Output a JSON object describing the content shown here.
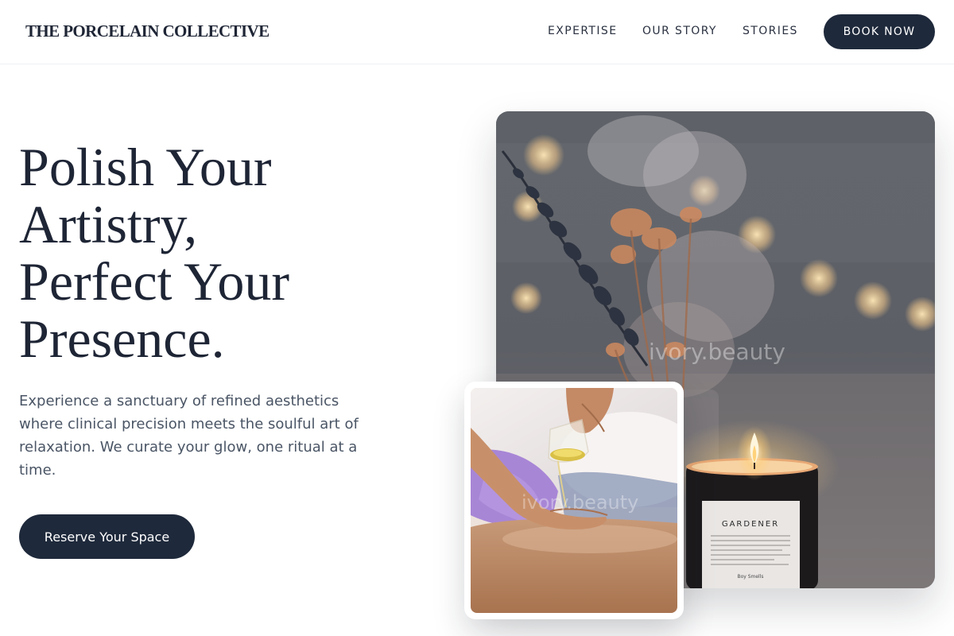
{
  "brand": {
    "name": "THE PORCELAIN COLLECTIVE"
  },
  "nav": {
    "items": [
      {
        "label": "EXPERTISE"
      },
      {
        "label": "OUR STORY"
      },
      {
        "label": "STORIES"
      }
    ],
    "cta_label": "BOOK NOW"
  },
  "hero": {
    "headline_lines": [
      "Polish Your",
      "Artistry,",
      "Perfect Your",
      "Presence."
    ],
    "description": "Experience a sanctuary of refined aesthetics where clinical precision meets the soulful art of relaxation. We curate your glow, one ritual at a time.",
    "cta_label": "Reserve Your Space"
  },
  "images": {
    "main": {
      "watermark": "ivory.beauty",
      "candle_label": "GARDENER",
      "candle_brand": "Boy  Smells"
    },
    "secondary": {
      "watermark": "ivory.beauty"
    }
  },
  "colors": {
    "primary": "#1e293b",
    "text_muted": "#4a5565",
    "background": "#ffffff"
  }
}
